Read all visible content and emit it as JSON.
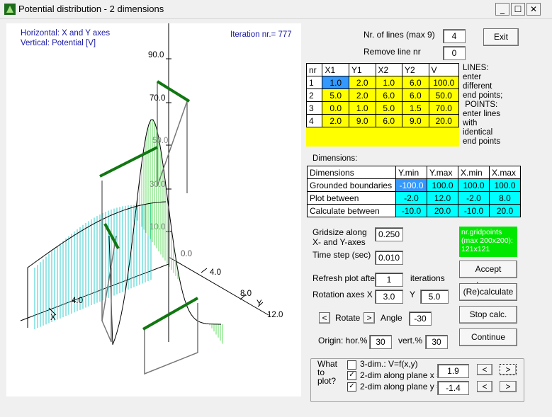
{
  "window": {
    "title": "Potential distribution - 2 dimensions",
    "minimize": "_",
    "maximize": "☐",
    "close": "✕"
  },
  "plot": {
    "header_line1": "Horizontal: X and Y axes",
    "header_line2": "Vertical: Potential [V]",
    "iteration": "Iteration nr.= 777",
    "ticks_v": [
      "90.0",
      "70.0",
      "50.0",
      "30.0",
      "10.0",
      "0.0"
    ],
    "ticks_x": [
      "4.0",
      "X"
    ],
    "ticks_y": [
      "4.0",
      "8.0",
      "Y",
      "12.0"
    ],
    "colors": {
      "surface_x": "#33cccc",
      "surface_y": "#66dd66",
      "lines": "#117711",
      "axes": "#000000"
    }
  },
  "controls": {
    "nr_lines_label": "Nr. of lines (max 9)",
    "nr_lines_value": "4",
    "remove_line_label": "Remove line nr",
    "remove_line_value": "0",
    "exit_label": "Exit"
  },
  "lines_table": {
    "headers": [
      "nr",
      "X1",
      "Y1",
      "X2",
      "Y2",
      "V"
    ],
    "rows": [
      [
        "1",
        "1.0",
        "2.0",
        "1.0",
        "6.0",
        "100.0"
      ],
      [
        "2",
        "5.0",
        "2.0",
        "6.0",
        "6.0",
        "50.0"
      ],
      [
        "3",
        "0.0",
        "1.0",
        "5.0",
        "1.5",
        "70.0"
      ],
      [
        "4",
        "2.0",
        "9.0",
        "6.0",
        "9.0",
        "20.0"
      ]
    ],
    "note": [
      "LINES:",
      "enter",
      "different",
      "end points;",
      " POINTS:",
      "enter lines",
      "with",
      "identical",
      "end points"
    ]
  },
  "dimensions": {
    "title": "Dimensions:",
    "headers": [
      "Dimensions",
      "Y.min",
      "Y.max",
      "X.min",
      "X.max"
    ],
    "rows": [
      [
        "Grounded boundaries",
        "-100.0",
        "100.0",
        "100.0",
        "100.0"
      ],
      [
        "Plot between",
        "-2.0",
        "12.0",
        "-2.0",
        "8.0"
      ],
      [
        "Calculate between",
        "-10.0",
        "20.0",
        "-10.0",
        "20.0"
      ]
    ]
  },
  "settings": {
    "gridsize_label1": "Gridsize along",
    "gridsize_label2": "X- and Y-axes",
    "gridsize_value": "0.250",
    "timestep_label": "Time step (sec)",
    "timestep_value": "0.010",
    "gridpoints": [
      "nr.gridpoints",
      "(max 200x200):",
      "121x121"
    ],
    "refresh_label": "Refresh plot after",
    "refresh_value": "1",
    "iterations_label": "iterations",
    "rotation_label": "Rotation axes  X",
    "rotation_x": "3.0",
    "rotation_y_label": "Y",
    "rotation_y": "5.0",
    "rotate_left": "<",
    "rotate_label": "Rotate",
    "rotate_right": ">",
    "angle_label": "Angle",
    "angle_value": "-30",
    "origin_label": "Origin: hor.%",
    "origin_hor": "30",
    "vert_label": "vert.%",
    "origin_vert": "30",
    "accept_label": "Accept changes",
    "recalc_label": "(Re)calculate",
    "stop_label": "Stop calc.",
    "continue_label": "Continue"
  },
  "plot_options": {
    "what_label": [
      "What",
      "to",
      "plot?"
    ],
    "opt1": "3-dim.: V=f(x,y)",
    "opt1_checked": false,
    "opt2": "2-dim along plane x =",
    "opt2_checked": true,
    "opt2_value": "1.9",
    "opt3": "2-dim along plane y =",
    "opt3_checked": true,
    "opt3_value": "-1.4",
    "left": "<",
    "right": ">",
    "mark": "✓"
  }
}
